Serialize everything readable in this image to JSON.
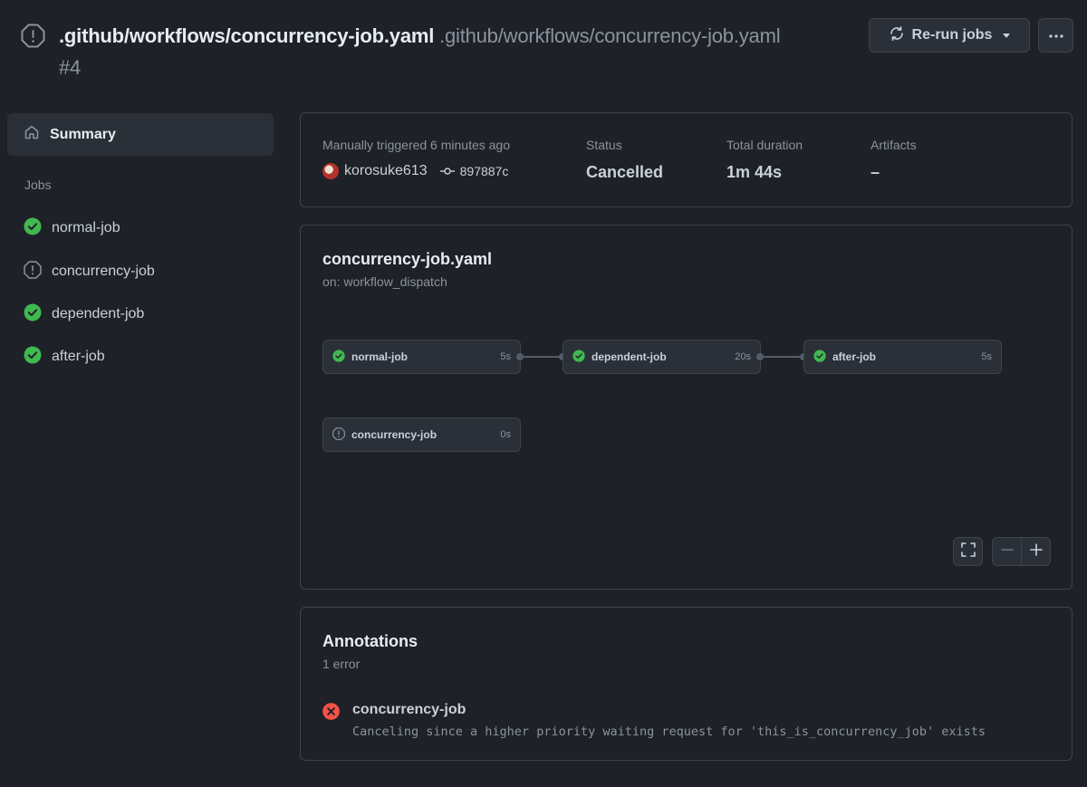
{
  "header": {
    "title_path": ".github/workflows/concurrency-job.yaml",
    "title_muted": ".github/workflows/concurrency-job.yaml",
    "run_number": "#4",
    "rerun_label": "Re-run jobs"
  },
  "sidebar": {
    "summary_label": "Summary",
    "jobs_label": "Jobs",
    "jobs": [
      {
        "label": "normal-job",
        "status": "success"
      },
      {
        "label": "concurrency-job",
        "status": "cancelled"
      },
      {
        "label": "dependent-job",
        "status": "success"
      },
      {
        "label": "after-job",
        "status": "success"
      }
    ]
  },
  "summary": {
    "trigger_label": "Manually triggered 6 minutes ago",
    "actor": "korosuke613",
    "commit": "897887c",
    "status_label": "Status",
    "status_value": "Cancelled",
    "duration_label": "Total duration",
    "duration_value": "1m 44s",
    "artifacts_label": "Artifacts",
    "artifacts_value": "–"
  },
  "workflow": {
    "title": "concurrency-job.yaml",
    "trigger": "on: workflow_dispatch",
    "nodes": [
      {
        "name": "normal-job",
        "duration": "5s",
        "status": "success"
      },
      {
        "name": "dependent-job",
        "duration": "20s",
        "status": "success"
      },
      {
        "name": "after-job",
        "duration": "5s",
        "status": "success"
      },
      {
        "name": "concurrency-job",
        "duration": "0s",
        "status": "cancelled"
      }
    ]
  },
  "annotations": {
    "title": "Annotations",
    "count": "1 error",
    "items": [
      {
        "job": "concurrency-job",
        "message": "Canceling since a higher priority waiting request for 'this_is_concurrency_job' exists"
      }
    ]
  },
  "colors": {
    "background": "#1e2127",
    "success": "#3fb950",
    "error": "#f85149",
    "muted": "#8b949e"
  }
}
